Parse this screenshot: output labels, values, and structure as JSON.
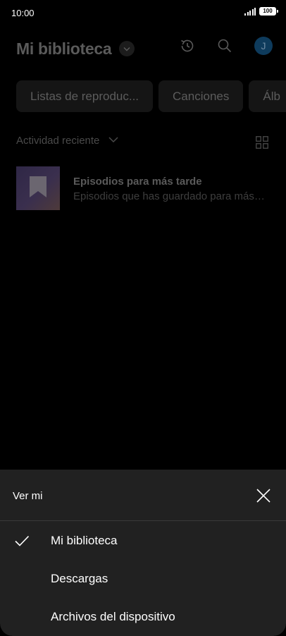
{
  "status_bar": {
    "time": "10:00",
    "battery": "100"
  },
  "header": {
    "title": "Mi biblioteca",
    "avatar_initial": "J",
    "icons": [
      "chevron-down-icon",
      "history-icon",
      "search-icon"
    ]
  },
  "chips": [
    {
      "label": "Listas de reproduc..."
    },
    {
      "label": "Canciones"
    },
    {
      "label": "Álb"
    }
  ],
  "sort": {
    "label": "Actividad reciente"
  },
  "recent": [
    {
      "title": "Episodios para más tarde",
      "subtitle": "Episodios que has guardado para más…"
    }
  ],
  "sheet": {
    "title": "Ver mi",
    "options": [
      {
        "label": "Mi biblioteca",
        "selected": true
      },
      {
        "label": "Descargas",
        "selected": false
      },
      {
        "label": "Archivos del dispositivo",
        "selected": false
      }
    ]
  },
  "colors": {
    "background": "#000000",
    "sheet": "#212121",
    "avatar": "#0e3b5c"
  }
}
